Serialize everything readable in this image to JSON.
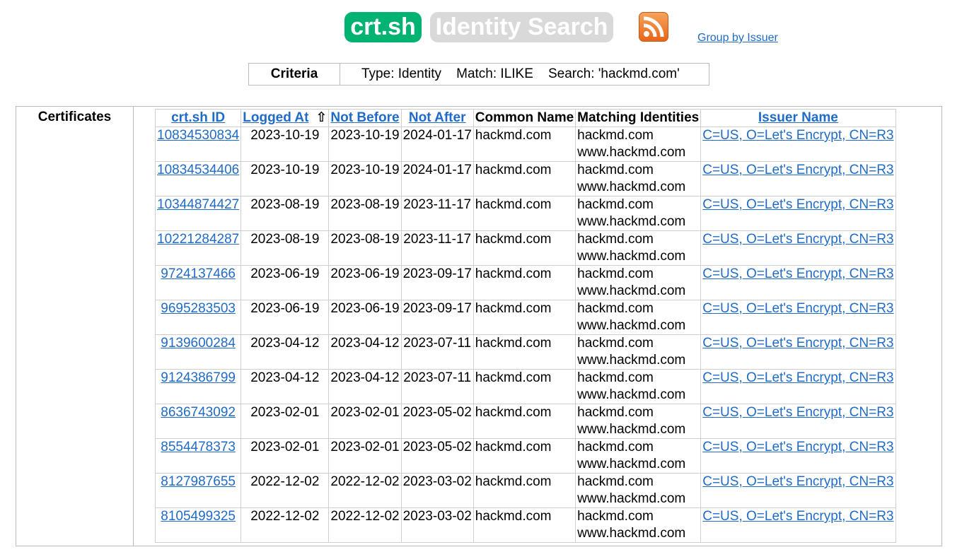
{
  "header": {
    "logo_main": "crt.sh",
    "logo_sub": "Identity Search",
    "rss_icon": "rss-feed-icon",
    "group_link": "Group by Issuer"
  },
  "criteria": {
    "label": "Criteria",
    "value": "Type: Identity    Match: ILIKE    Search: 'hackmd.com'"
  },
  "certificates": {
    "section_label": "Certificates",
    "columns": [
      {
        "label": "crt.sh ID",
        "link": true
      },
      {
        "label": "Logged At",
        "link": true,
        "sort_icon": "sort-up-arrow-icon",
        "sort_glyph": "⇧"
      },
      {
        "label": "Not Before",
        "link": true
      },
      {
        "label": "Not After",
        "link": true
      },
      {
        "label": "Common Name",
        "link": false
      },
      {
        "label": "Matching Identities",
        "link": false
      },
      {
        "label": "Issuer Name",
        "link": true
      }
    ],
    "rows": [
      {
        "id": "10834530834",
        "logged_at": "2023-10-19",
        "not_before": "2023-10-19",
        "not_after": "2024-01-17",
        "common_name": "hackmd.com",
        "identities": [
          "hackmd.com",
          "www.hackmd.com"
        ],
        "issuer": "C=US, O=Let's Encrypt, CN=R3"
      },
      {
        "id": "10834534406",
        "logged_at": "2023-10-19",
        "not_before": "2023-10-19",
        "not_after": "2024-01-17",
        "common_name": "hackmd.com",
        "identities": [
          "hackmd.com",
          "www.hackmd.com"
        ],
        "issuer": "C=US, O=Let's Encrypt, CN=R3"
      },
      {
        "id": "10344874427",
        "logged_at": "2023-08-19",
        "not_before": "2023-08-19",
        "not_after": "2023-11-17",
        "common_name": "hackmd.com",
        "identities": [
          "hackmd.com",
          "www.hackmd.com"
        ],
        "issuer": "C=US, O=Let's Encrypt, CN=R3"
      },
      {
        "id": "10221284287",
        "logged_at": "2023-08-19",
        "not_before": "2023-08-19",
        "not_after": "2023-11-17",
        "common_name": "hackmd.com",
        "identities": [
          "hackmd.com",
          "www.hackmd.com"
        ],
        "issuer": "C=US, O=Let's Encrypt, CN=R3"
      },
      {
        "id": "9724137466",
        "logged_at": "2023-06-19",
        "not_before": "2023-06-19",
        "not_after": "2023-09-17",
        "common_name": "hackmd.com",
        "identities": [
          "hackmd.com",
          "www.hackmd.com"
        ],
        "issuer": "C=US, O=Let's Encrypt, CN=R3"
      },
      {
        "id": "9695283503",
        "logged_at": "2023-06-19",
        "not_before": "2023-06-19",
        "not_after": "2023-09-17",
        "common_name": "hackmd.com",
        "identities": [
          "hackmd.com",
          "www.hackmd.com"
        ],
        "issuer": "C=US, O=Let's Encrypt, CN=R3"
      },
      {
        "id": "9139600284",
        "logged_at": "2023-04-12",
        "not_before": "2023-04-12",
        "not_after": "2023-07-11",
        "common_name": "hackmd.com",
        "identities": [
          "hackmd.com",
          "www.hackmd.com"
        ],
        "issuer": "C=US, O=Let's Encrypt, CN=R3"
      },
      {
        "id": "9124386799",
        "logged_at": "2023-04-12",
        "not_before": "2023-04-12",
        "not_after": "2023-07-11",
        "common_name": "hackmd.com",
        "identities": [
          "hackmd.com",
          "www.hackmd.com"
        ],
        "issuer": "C=US, O=Let's Encrypt, CN=R3"
      },
      {
        "id": "8636743092",
        "logged_at": "2023-02-01",
        "not_before": "2023-02-01",
        "not_after": "2023-05-02",
        "common_name": "hackmd.com",
        "identities": [
          "hackmd.com",
          "www.hackmd.com"
        ],
        "issuer": "C=US, O=Let's Encrypt, CN=R3"
      },
      {
        "id": "8554478373",
        "logged_at": "2023-02-01",
        "not_before": "2023-02-01",
        "not_after": "2023-05-02",
        "common_name": "hackmd.com",
        "identities": [
          "hackmd.com",
          "www.hackmd.com"
        ],
        "issuer": "C=US, O=Let's Encrypt, CN=R3"
      },
      {
        "id": "8127987655",
        "logged_at": "2022-12-02",
        "not_before": "2022-12-02",
        "not_after": "2023-03-02",
        "common_name": "hackmd.com",
        "identities": [
          "hackmd.com",
          "www.hackmd.com"
        ],
        "issuer": "C=US, O=Let's Encrypt, CN=R3"
      },
      {
        "id": "8105499325",
        "logged_at": "2022-12-02",
        "not_before": "2022-12-02",
        "not_after": "2023-03-02",
        "common_name": "hackmd.com",
        "identities": [
          "hackmd.com",
          "www.hackmd.com"
        ],
        "issuer": "C=US, O=Let's Encrypt, CN=R3"
      }
    ]
  }
}
